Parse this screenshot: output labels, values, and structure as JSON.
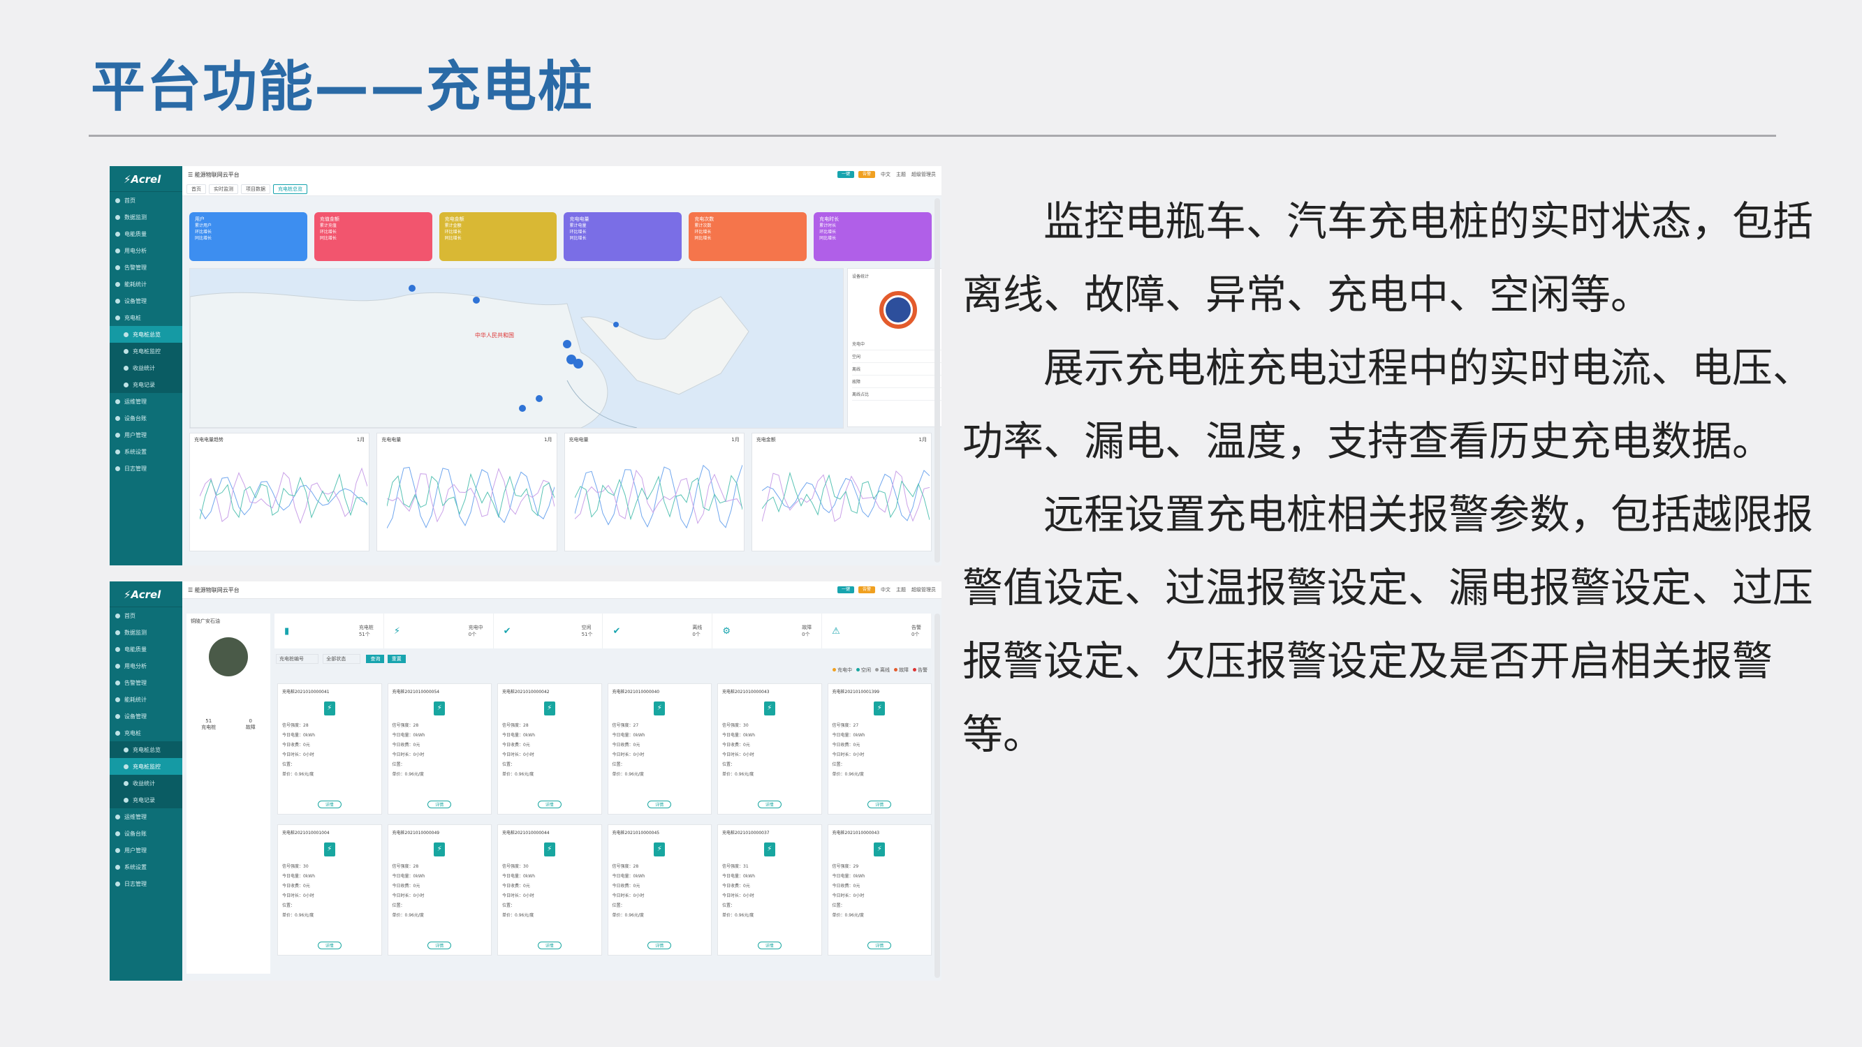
{
  "slide": {
    "title": "平台功能——充电桩",
    "paragraphs": [
      "　　监控电瓶车、汽车充电桩的实时状态，包括离线、故障、异常、充电中、空闲等。",
      "　　展示充电桩充电过程中的实时电流、电压、功率、漏电、温度，支持查看历史充电数据。",
      "　　远程设置充电桩相关报警参数，包括越限报警值设定、过温报警设定、漏电报警设定、过压报警设定、欠压报警设定及是否开启相关报警等。"
    ]
  },
  "screenshot1": {
    "logo": "Acrel",
    "app_title": "能源物联网云平台",
    "top_right": [
      "一键",
      "告警",
      "中文",
      "主题",
      "超级管理员"
    ],
    "sidebar": [
      "首页",
      "数据监测",
      "电能质量",
      "用电分析",
      "告警管理",
      "能耗统计",
      "设备管理",
      "充电桩",
      "充电桩总览",
      "充电桩监控",
      "收益统计",
      "充电记录",
      "运维管理",
      "设备台账",
      "用户管理",
      "系统设置",
      "日志管理"
    ],
    "tabs": [
      "首页",
      "实时监测",
      "项目数据",
      "充电桩总览"
    ],
    "cards": [
      {
        "title": "用户",
        "color": "#3d8ef0",
        "l1": "累计用户",
        "l2": "环比增长",
        "l3": "同比增长"
      },
      {
        "title": "充值金额",
        "color": "#f2556e",
        "l1": "累计充值",
        "l2": "环比增长",
        "l3": "同比增长"
      },
      {
        "title": "充电金额",
        "color": "#d9b834",
        "l1": "累计金额",
        "l2": "环比增长",
        "l3": "同比增长"
      },
      {
        "title": "充电电量",
        "color": "#7a6ee6",
        "l1": "累计电量",
        "l2": "环比增长",
        "l3": "同比增长"
      },
      {
        "title": "充电次数",
        "color": "#f5754b",
        "l1": "累计次数",
        "l2": "环比增长",
        "l3": "同比增长"
      },
      {
        "title": "充电时长",
        "color": "#b05fe8",
        "l1": "累计时长",
        "l2": "环比增长",
        "l3": "同比增长"
      }
    ],
    "map_label": "中华人民共和国",
    "status_title": "设备统计",
    "status_rows": [
      "充电中",
      "空闲",
      "离线",
      "故障",
      "离线占比"
    ],
    "panels": [
      {
        "title": "充电电量趋势",
        "range": "1月"
      },
      {
        "title": "充电电量",
        "range": "1月"
      },
      {
        "title": "充电电量",
        "range": "1月"
      },
      {
        "title": "充电金额",
        "range": "1月"
      }
    ]
  },
  "screenshot2": {
    "site_name": "铜陵广安石油",
    "stats": [
      {
        "label": "充电桩",
        "value": "51个"
      },
      {
        "label": "充电中",
        "value": "0个"
      },
      {
        "label": "空闲",
        "value": "51个"
      },
      {
        "label": "离线",
        "value": "0个"
      },
      {
        "label": "故障",
        "value": "0个"
      },
      {
        "label": "告警",
        "value": "0个"
      }
    ],
    "buttons": [
      "查询",
      "重置"
    ],
    "filter_placeholder": "充电桩编号",
    "filter_select": "全部状态",
    "legend": [
      "充电中",
      "空闲",
      "离线",
      "故障",
      "告警"
    ],
    "left_stats": [
      {
        "num": "51",
        "label": "充电桩"
      },
      {
        "num": "0",
        "label": "故障"
      }
    ],
    "piles": [
      {
        "id": "充电桩2021010000041",
        "rows": [
          "信号强度：28",
          "今日电量：0kWh",
          "今日收费：0元",
          "今日时长：0小时",
          "位置：",
          "单价：0.96元/度"
        ],
        "btn": "详情"
      },
      {
        "id": "充电桩2021010000054",
        "rows": [
          "信号强度：28",
          "今日电量：0kWh",
          "今日收费：0元",
          "今日时长：0小时",
          "位置：",
          "单价：0.96元/度"
        ],
        "btn": "详情"
      },
      {
        "id": "充电桩2021010000042",
        "rows": [
          "信号强度：28",
          "今日电量：0kWh",
          "今日收费：0元",
          "今日时长：0小时",
          "位置：",
          "单价：0.96元/度"
        ],
        "btn": "详情"
      },
      {
        "id": "充电桩2021010000040",
        "rows": [
          "信号强度：27",
          "今日电量：0kWh",
          "今日收费：0元",
          "今日时长：0小时",
          "位置：",
          "单价：0.96元/度"
        ],
        "btn": "详情"
      },
      {
        "id": "充电桩2021010000043",
        "rows": [
          "信号强度：30",
          "今日电量：0kWh",
          "今日收费：0元",
          "今日时长：0小时",
          "位置：",
          "单价：0.96元/度"
        ],
        "btn": "详情"
      },
      {
        "id": "充电桩2021010001399",
        "rows": [
          "信号强度：27",
          "今日电量：0kWh",
          "今日收费：0元",
          "今日时长：0小时",
          "位置：",
          "单价：0.96元/度"
        ],
        "btn": "详情"
      },
      {
        "id": "充电桩2021010001004",
        "rows": [
          "信号强度：30",
          "今日电量：0kWh",
          "今日收费：0元",
          "今日时长：0小时",
          "位置：",
          "单价：0.96元/度"
        ],
        "btn": "详情"
      },
      {
        "id": "充电桩2021010000049",
        "rows": [
          "信号强度：28",
          "今日电量：0kWh",
          "今日收费：0元",
          "今日时长：0小时",
          "位置：",
          "单价：0.96元/度"
        ],
        "btn": "详情"
      },
      {
        "id": "充电桩2021010000044",
        "rows": [
          "信号强度：30",
          "今日电量：0kWh",
          "今日收费：0元",
          "今日时长：0小时",
          "位置：",
          "单价：0.96元/度"
        ],
        "btn": "详情"
      },
      {
        "id": "充电桩2021010000045",
        "rows": [
          "信号强度：28",
          "今日电量：0kWh",
          "今日收费：0元",
          "今日时长：0小时",
          "位置：",
          "单价：0.96元/度"
        ],
        "btn": "详情"
      },
      {
        "id": "充电桩2021010000037",
        "rows": [
          "信号强度：31",
          "今日电量：0kWh",
          "今日收费：0元",
          "今日时长：0小时",
          "位置：",
          "单价：0.96元/度"
        ],
        "btn": "详情"
      },
      {
        "id": "充电桩2021010000043",
        "rows": [
          "信号强度：29",
          "今日电量：0kWh",
          "今日收费：0元",
          "今日时长：0小时",
          "位置：",
          "单价：0.96元/度"
        ],
        "btn": "详情"
      }
    ]
  }
}
